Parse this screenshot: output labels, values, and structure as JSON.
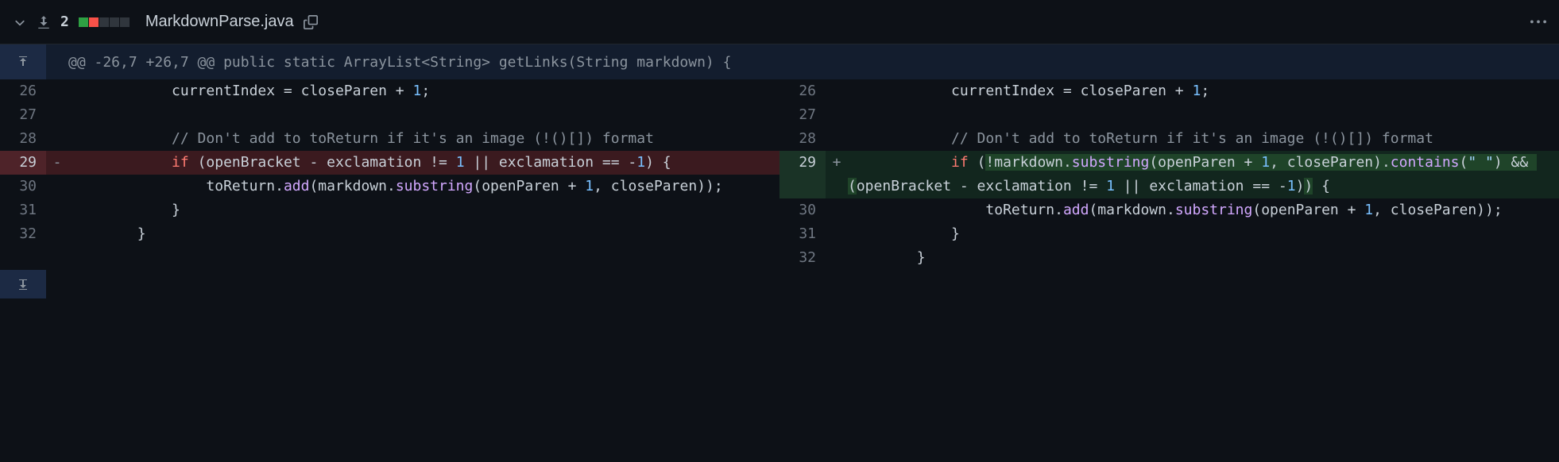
{
  "header": {
    "change_count": "2",
    "filename": "MarkdownParse.java"
  },
  "hunk": {
    "text": "@@ -26,7 +26,7 @@ public static ArrayList<String> getLinks(String markdown) {"
  },
  "left": {
    "lines": [
      {
        "num": "26",
        "marker": "",
        "type": "ctx",
        "html": "            currentIndex = closeParen + <span class='tok-num'>1</span>;"
      },
      {
        "num": "27",
        "marker": "",
        "type": "ctx",
        "html": ""
      },
      {
        "num": "28",
        "marker": "",
        "type": "ctx",
        "html": "            <span class='tok-cm'>// Don't add to toReturn if it's an image (!()[]) format</span>"
      },
      {
        "num": "29",
        "marker": "-",
        "type": "del",
        "html": "            <span class='tok-kw'>if</span> (openBracket - exclamation != <span class='tok-num'>1</span> || exclamation == -<span class='tok-num'>1</span>) {"
      },
      {
        "num": "30",
        "marker": "",
        "type": "ctx",
        "html": "                toReturn.<span class='tok-fn'>add</span>(markdown.<span class='tok-fn'>substring</span>(openParen + <span class='tok-num'>1</span>, closeParen));"
      },
      {
        "num": "31",
        "marker": "",
        "type": "ctx",
        "html": "            }"
      },
      {
        "num": "32",
        "marker": "",
        "type": "ctx",
        "html": "        }"
      }
    ]
  },
  "right": {
    "lines": [
      {
        "num": "26",
        "marker": "",
        "type": "ctx",
        "html": "            currentIndex = closeParen + <span class='tok-num'>1</span>;"
      },
      {
        "num": "27",
        "marker": "",
        "type": "ctx",
        "html": ""
      },
      {
        "num": "28",
        "marker": "",
        "type": "ctx",
        "html": "            <span class='tok-cm'>// Don't add to toReturn if it's an image (!()[]) format</span>"
      },
      {
        "num": "29",
        "marker": "+",
        "type": "add",
        "html": "            <span class='tok-kw'>if</span> (<span class='hl-add'>!markdown.<span class='tok-fn'>substring</span>(openParen + <span class='tok-num'>1</span>, closeParen).<span class='tok-fn'>contains</span>(<span class='tok-str'>\" \"</span>) && (</span>openBracket - exclamation != <span class='tok-num'>1</span> || exclamation == -<span class='tok-num'>1</span>)<span class='hl-add'>)</span> {"
      },
      {
        "num": "30",
        "marker": "",
        "type": "ctx",
        "html": "                toReturn.<span class='tok-fn'>add</span>(markdown.<span class='tok-fn'>substring</span>(openParen + <span class='tok-num'>1</span>, closeParen));"
      },
      {
        "num": "31",
        "marker": "",
        "type": "ctx",
        "html": "            }"
      },
      {
        "num": "32",
        "marker": "",
        "type": "ctx",
        "html": "        }"
      }
    ]
  }
}
